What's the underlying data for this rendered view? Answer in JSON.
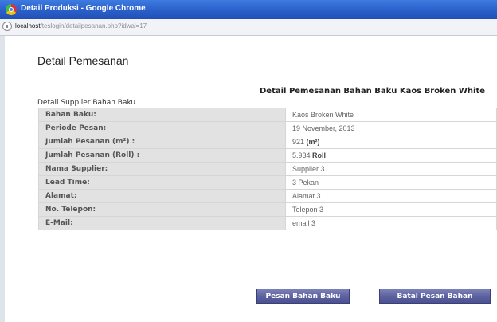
{
  "window": {
    "title": "Detail Produksi - Google Chrome"
  },
  "address": {
    "host": "localhost",
    "path": "/teslogin/detailpesanan.php?idwal=17"
  },
  "page": {
    "title": "Detail Pemesanan",
    "section_title": "Detail Pemesanan Bahan Baku Kaos Broken White",
    "table_caption": "Detail Supplier Bahan Baku"
  },
  "rows": [
    {
      "label": "Bahan Baku:",
      "value": "Kaos Broken White",
      "unit": ""
    },
    {
      "label": "Periode Pesan:",
      "value": "19 November, 2013",
      "unit": ""
    },
    {
      "label": "Jumlah Pesanan (m²) :",
      "value": "921",
      "unit": "(m²)"
    },
    {
      "label": "Jumlah Pesanan (Roll) :",
      "value": "5.934",
      "unit": "Roll"
    },
    {
      "label": "Nama Supplier:",
      "value": "Supplier 3",
      "unit": ""
    },
    {
      "label": "Lead Time:",
      "value": "3 Pekan",
      "unit": ""
    },
    {
      "label": "Alamat:",
      "value": "Alamat 3",
      "unit": ""
    },
    {
      "label": "No. Telepon:",
      "value": "Telepon 3",
      "unit": ""
    },
    {
      "label": "E-Mail:",
      "value": "email 3",
      "unit": ""
    }
  ],
  "buttons": {
    "pesan": "Pesan Bahan Baku",
    "batal": "Batal Pesan Bahan"
  }
}
